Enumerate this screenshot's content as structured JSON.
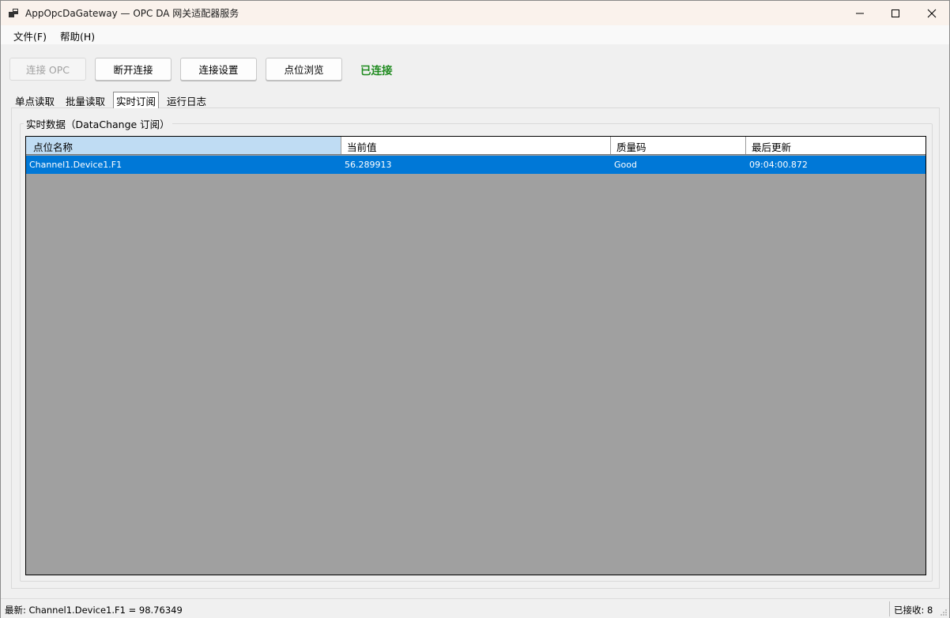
{
  "window": {
    "title": "AppOpcDaGateway — OPC DA 网关适配器服务",
    "icon": "app-window-icon"
  },
  "menu": {
    "file": "文件(F)",
    "help": "帮助(H)"
  },
  "toolbar": {
    "connect_label": "连接 OPC",
    "disconnect_label": "断开连接",
    "settings_label": "连接设置",
    "browse_label": "点位浏览",
    "status": "已连接",
    "status_color": "#1e8a1e"
  },
  "tabs": [
    {
      "label": "单点读取",
      "selected": false
    },
    {
      "label": "批量读取",
      "selected": false
    },
    {
      "label": "实时订阅",
      "selected": true
    },
    {
      "label": "运行日志",
      "selected": false
    }
  ],
  "group": {
    "title": "实时数据（DataChange 订阅）"
  },
  "grid": {
    "columns": [
      "点位名称",
      "当前值",
      "质量码",
      "最后更新"
    ],
    "rows": [
      {
        "name": "Channel1.Device1.F1",
        "value": "56.289913",
        "quality": "Good",
        "updated": "09:04:00.872",
        "selected": true
      }
    ],
    "selection_color": "#0078d7",
    "empty_color": "#a0a0a0"
  },
  "statusbar": {
    "latest": "最新: Channel1.Device1.F1 = 98.76349",
    "received": "已接收: 8"
  }
}
